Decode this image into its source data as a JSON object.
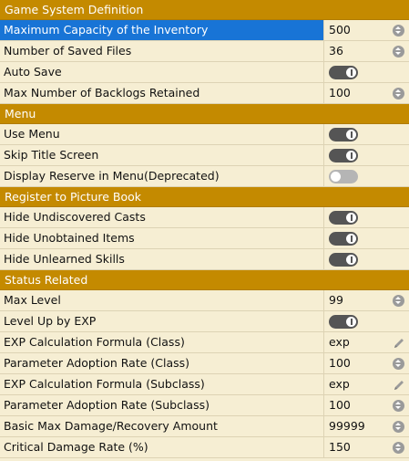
{
  "sections": [
    {
      "title": "Game System Definition",
      "rows": [
        {
          "label": "Maximum Capacity of the Inventory",
          "kind": "number",
          "value": "500",
          "selected": true
        },
        {
          "label": "Number of Saved Files",
          "kind": "number",
          "value": "36"
        },
        {
          "label": "Auto Save",
          "kind": "toggle",
          "on": true
        },
        {
          "label": "Max Number of Backlogs Retained",
          "kind": "number",
          "value": "100"
        }
      ]
    },
    {
      "title": "Menu",
      "rows": [
        {
          "label": "Use Menu",
          "kind": "toggle",
          "on": true
        },
        {
          "label": "Skip Title Screen",
          "kind": "toggle",
          "on": true
        },
        {
          "label": "Display Reserve in Menu(Deprecated)",
          "kind": "toggle",
          "on": false
        }
      ]
    },
    {
      "title": "Register to Picture Book",
      "rows": [
        {
          "label": "Hide Undiscovered Casts",
          "kind": "toggle",
          "on": true
        },
        {
          "label": "Hide Unobtained Items",
          "kind": "toggle",
          "on": true
        },
        {
          "label": "Hide Unlearned Skills",
          "kind": "toggle",
          "on": true
        }
      ]
    },
    {
      "title": "Status Related",
      "rows": [
        {
          "label": "Max Level",
          "kind": "number",
          "value": "99"
        },
        {
          "label": "Level Up by EXP",
          "kind": "toggle",
          "on": true
        },
        {
          "label": "EXP Calculation Formula (Class)",
          "kind": "formula",
          "value": "exp"
        },
        {
          "label": "Parameter Adoption Rate (Class)",
          "kind": "number",
          "value": "100"
        },
        {
          "label": "EXP Calculation Formula (Subclass)",
          "kind": "formula",
          "value": "exp"
        },
        {
          "label": "Parameter Adoption Rate (Subclass)",
          "kind": "number",
          "value": "100"
        },
        {
          "label": "Basic Max Damage/Recovery Amount",
          "kind": "number",
          "value": "99999"
        },
        {
          "label": "Critical Damage Rate (%)",
          "kind": "number",
          "value": "150"
        }
      ]
    }
  ],
  "icons": {
    "spinner": "spinner-icon",
    "edit": "pencil-icon",
    "toggle": "toggle-switch"
  },
  "colors": {
    "section_bg": "#c48a00",
    "row_bg": "#f6eed3",
    "selected_bg": "#1874d6",
    "toggle_on": "#555555",
    "toggle_off": "#b5b5b5"
  }
}
